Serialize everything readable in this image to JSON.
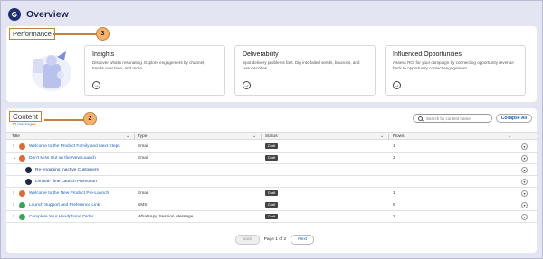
{
  "header": {
    "title": "Overview"
  },
  "performance": {
    "label": "Performance",
    "callout": "3",
    "tiles": [
      {
        "title": "Insights",
        "description": "Discover what's resonating. Explore engagement by channel, trends over time, and more."
      },
      {
        "title": "Deliverability",
        "description": "Spot delivery problems fast. Dig into failed sends, bounces, and unsubscribes."
      },
      {
        "title": "Influenced Opportunities",
        "description": "Assess ROI for your campaign by connecting opportunity revenue back to opportunity contact engagement."
      }
    ]
  },
  "content": {
    "label": "Content",
    "count": "10 messages",
    "callout": "2",
    "search_placeholder": "Search by content name",
    "collapse_label": "Collapse All",
    "columns": {
      "title": "Title",
      "type": "Type",
      "status": "Status",
      "flows": "Flows"
    },
    "rows": [
      {
        "title": "Welcome to the Product Family and Next Steps",
        "type": "Email",
        "status": "Draft",
        "flows": "1",
        "icon": "email-icon",
        "expander": "›"
      },
      {
        "title": "Don't Miss Out on the New Launch",
        "type": "Email",
        "status": "Draft",
        "flows": "2",
        "icon": "email-icon",
        "expander": "⌄"
      },
      {
        "title": "Re-engaging Inactive Customers",
        "type": "",
        "status": "",
        "flows": "",
        "icon": "journey-icon",
        "expander": ""
      },
      {
        "title": "Limited-Time Launch Promotion",
        "type": "",
        "status": "",
        "flows": "",
        "icon": "journey-icon",
        "expander": ""
      },
      {
        "title": "Welcome to the New Product Pre-Launch",
        "type": "Email",
        "status": "Draft",
        "flows": "1",
        "icon": "email-icon",
        "expander": "›"
      },
      {
        "title": "Launch Support and Preference Link",
        "type": "SMS",
        "status": "Draft",
        "flows": "6",
        "icon": "sms-icon",
        "expander": "›"
      },
      {
        "title": "Complete Your Headphone Order",
        "type": "WhatsApp Session Message",
        "status": "Draft",
        "flows": "2",
        "icon": "whatsapp-icon",
        "expander": "›"
      }
    ],
    "pagination": {
      "back": "Back",
      "info": "Page 1 of 2",
      "next": "Next"
    }
  },
  "colors": {
    "accent": "#1b5fb6",
    "callout": "#f4b26c",
    "draft_badge": "#444444",
    "email_icon": "#dd6b3a",
    "sms_icon": "#3aa35a"
  }
}
